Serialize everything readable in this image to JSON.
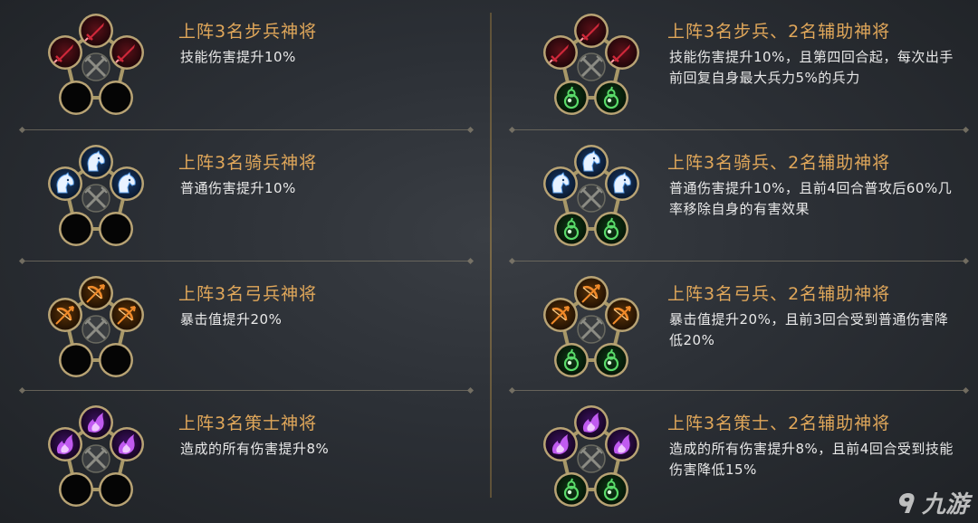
{
  "left_column": [
    {
      "title": "上阵3名步兵神将",
      "desc": "技能伤害提升10%",
      "unit": "infantry",
      "support_slots": 0
    },
    {
      "title": "上阵3名骑兵神将",
      "desc": "普通伤害提升10%",
      "unit": "cavalry",
      "support_slots": 0
    },
    {
      "title": "上阵3名弓兵神将",
      "desc": "暴击值提升20%",
      "unit": "archer",
      "support_slots": 0
    },
    {
      "title": "上阵3名策士神将",
      "desc": "造成的所有伤害提升8%",
      "unit": "strategist",
      "support_slots": 0
    }
  ],
  "right_column": [
    {
      "title": "上阵3名步兵、2名辅助神将",
      "desc": "技能伤害提升10%，且第四回合起，每次出手前回复自身最大兵力5%的兵力",
      "unit": "infantry",
      "support_slots": 2
    },
    {
      "title": "上阵3名骑兵、2名辅助神将",
      "desc": "普通伤害提升10%，且前4回合普攻后60%几率移除自身的有害效果",
      "unit": "cavalry",
      "support_slots": 2
    },
    {
      "title": "上阵3名弓兵、2名辅助神将",
      "desc": "暴击值提升20%，且前3回合受到普通伤害降低20%",
      "unit": "archer",
      "support_slots": 2
    },
    {
      "title": "上阵3名策士、2名辅助神将",
      "desc": "造成的所有伤害提升8%，且前4回合受到技能伤害降低15%",
      "unit": "strategist",
      "support_slots": 2
    }
  ],
  "icons": {
    "infantry": "sword-icon",
    "cavalry": "horse-head-icon",
    "archer": "bow-arrow-icon",
    "strategist": "purple-flame-icon",
    "support": "green-gourd-icon",
    "center": "crossed-swords-icon"
  },
  "colors": {
    "title": "#e0a75a",
    "desc": "#e9e9e9",
    "infantry": "#d0283a",
    "cavalry": "#5a9ee8",
    "archer": "#f08a2a",
    "strategist": "#c05af0",
    "support": "#5adc6a"
  },
  "watermark": {
    "text": "九游"
  }
}
